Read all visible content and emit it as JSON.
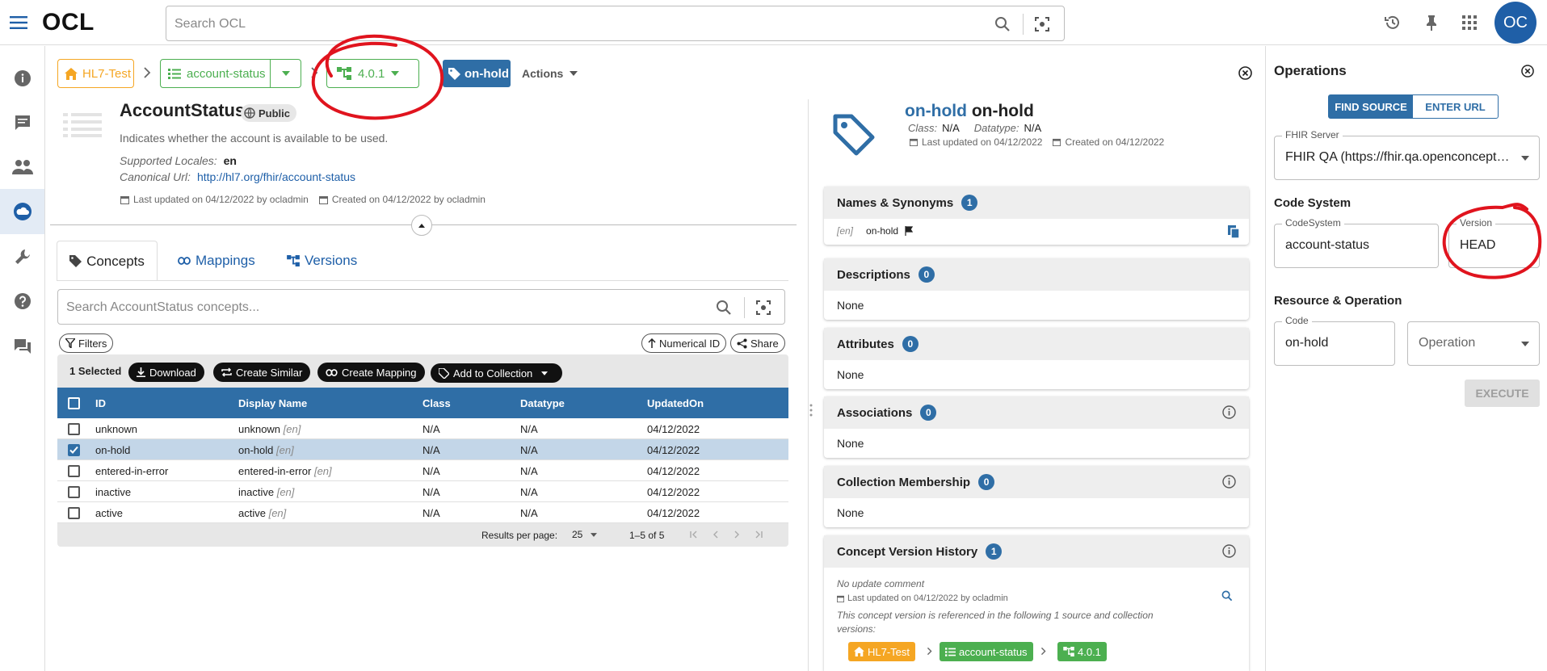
{
  "app": {
    "logo": "OCL",
    "search_placeholder": "Search OCL",
    "avatar_initials": "OC"
  },
  "breadcrumb": {
    "org": "HL7-Test",
    "source": "account-status",
    "version": "4.0.1",
    "concept_tag": "on-hold",
    "actions_label": "Actions"
  },
  "concept_header": {
    "title": "AccountStatus",
    "visibility": "Public",
    "description": "Indicates whether the account is available to be used.",
    "supported_locales_label": "Supported Locales:",
    "supported_locales_value": "en",
    "canonical_url_label": "Canonical Url:",
    "canonical_url_value": "http://hl7.org/fhir/account-status",
    "last_updated": "Last updated on 04/12/2022 by ocladmin",
    "created": "Created on 04/12/2022 by ocladmin"
  },
  "tabs": [
    "Concepts",
    "Mappings",
    "Versions"
  ],
  "concept_search_placeholder": "Search AccountStatus concepts...",
  "toolbar": {
    "filters": "Filters",
    "numerical_id": "Numerical ID",
    "share": "Share",
    "selected": "1 Selected",
    "download": "Download",
    "create_similar": "Create Similar",
    "create_mapping": "Create Mapping",
    "add_to_collection": "Add to Collection"
  },
  "table": {
    "headers": [
      "ID",
      "Display Name",
      "Class",
      "Datatype",
      "UpdatedOn"
    ],
    "rows": [
      {
        "id": "unknown",
        "display": "unknown",
        "lang": "[en]",
        "class": "N/A",
        "datatype": "N/A",
        "updated": "04/12/2022",
        "selected": false
      },
      {
        "id": "on-hold",
        "display": "on-hold",
        "lang": "[en]",
        "class": "N/A",
        "datatype": "N/A",
        "updated": "04/12/2022",
        "selected": true
      },
      {
        "id": "entered-in-error",
        "display": "entered-in-error",
        "lang": "[en]",
        "class": "N/A",
        "datatype": "N/A",
        "updated": "04/12/2022",
        "selected": false
      },
      {
        "id": "inactive",
        "display": "inactive",
        "lang": "[en]",
        "class": "N/A",
        "datatype": "N/A",
        "updated": "04/12/2022",
        "selected": false
      },
      {
        "id": "active",
        "display": "active",
        "lang": "[en]",
        "class": "N/A",
        "datatype": "N/A",
        "updated": "04/12/2022",
        "selected": false
      }
    ],
    "results_per_page_label": "Results per page:",
    "results_per_page": "25",
    "range": "1–5 of 5"
  },
  "concept_detail": {
    "id": "on-hold",
    "name": "on-hold",
    "class_label": "Class:",
    "class_value": "N/A",
    "datatype_label": "Datatype:",
    "datatype_value": "N/A",
    "last_updated": "Last updated on 04/12/2022",
    "created": "Created on 04/12/2022",
    "names_title": "Names & Synonyms",
    "names_count": "1",
    "name_lang": "[en]",
    "name_value": "on-hold",
    "descriptions_title": "Descriptions",
    "descriptions_count": "0",
    "descriptions_body": "None",
    "attributes_title": "Attributes",
    "attributes_count": "0",
    "attributes_body": "None",
    "associations_title": "Associations",
    "associations_count": "0",
    "associations_body": "None",
    "collections_title": "Collection Membership",
    "collections_count": "0",
    "collections_body": "None",
    "history_title": "Concept Version History",
    "history_count": "1",
    "history_comment": "No update comment",
    "history_updated": "Last updated on 04/12/2022 by ocladmin",
    "history_note": "This concept version is referenced in the following 1 source and collection versions:",
    "history_org": "HL7-Test",
    "history_source": "account-status",
    "history_version": "4.0.1"
  },
  "operations": {
    "title": "Operations",
    "find_source": "FIND SOURCE",
    "enter_url": "ENTER URL",
    "fhir_server_label": "FHIR Server",
    "fhir_server_value": "FHIR QA (https://fhir.qa.openconcept…",
    "code_system_title": "Code System",
    "codesystem_label": "CodeSystem",
    "codesystem_value": "account-status",
    "version_label": "Version",
    "version_value": "HEAD",
    "resource_title": "Resource & Operation",
    "code_label": "Code",
    "code_value": "on-hold",
    "operation_placeholder": "Operation",
    "execute": "EXECUTE"
  },
  "colors": {
    "primary": "#2f6ea6",
    "orange": "#f5a623",
    "green": "#4caf50",
    "annotation_red": "#e0141e"
  }
}
